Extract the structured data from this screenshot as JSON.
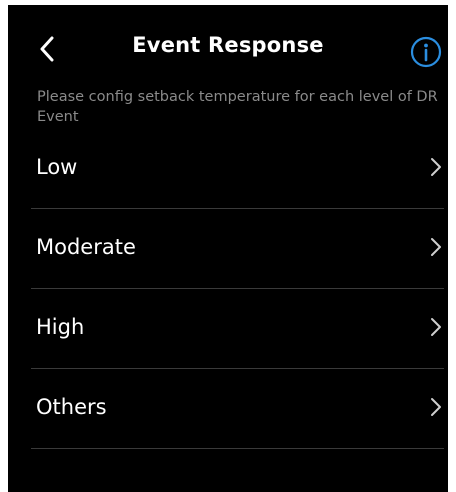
{
  "header": {
    "title": "Event Response",
    "back_icon": "chevron-left-icon",
    "info_icon": "info-circle-icon",
    "accent_color": "#2b8ee0"
  },
  "description": "Please config setback temperature for each level of DR Event",
  "levels": [
    {
      "label": "Low",
      "icon": "chevron-right-icon"
    },
    {
      "label": "Moderate",
      "icon": "chevron-right-icon"
    },
    {
      "label": "High",
      "icon": "chevron-right-icon"
    },
    {
      "label": "Others",
      "icon": "chevron-right-icon"
    }
  ]
}
